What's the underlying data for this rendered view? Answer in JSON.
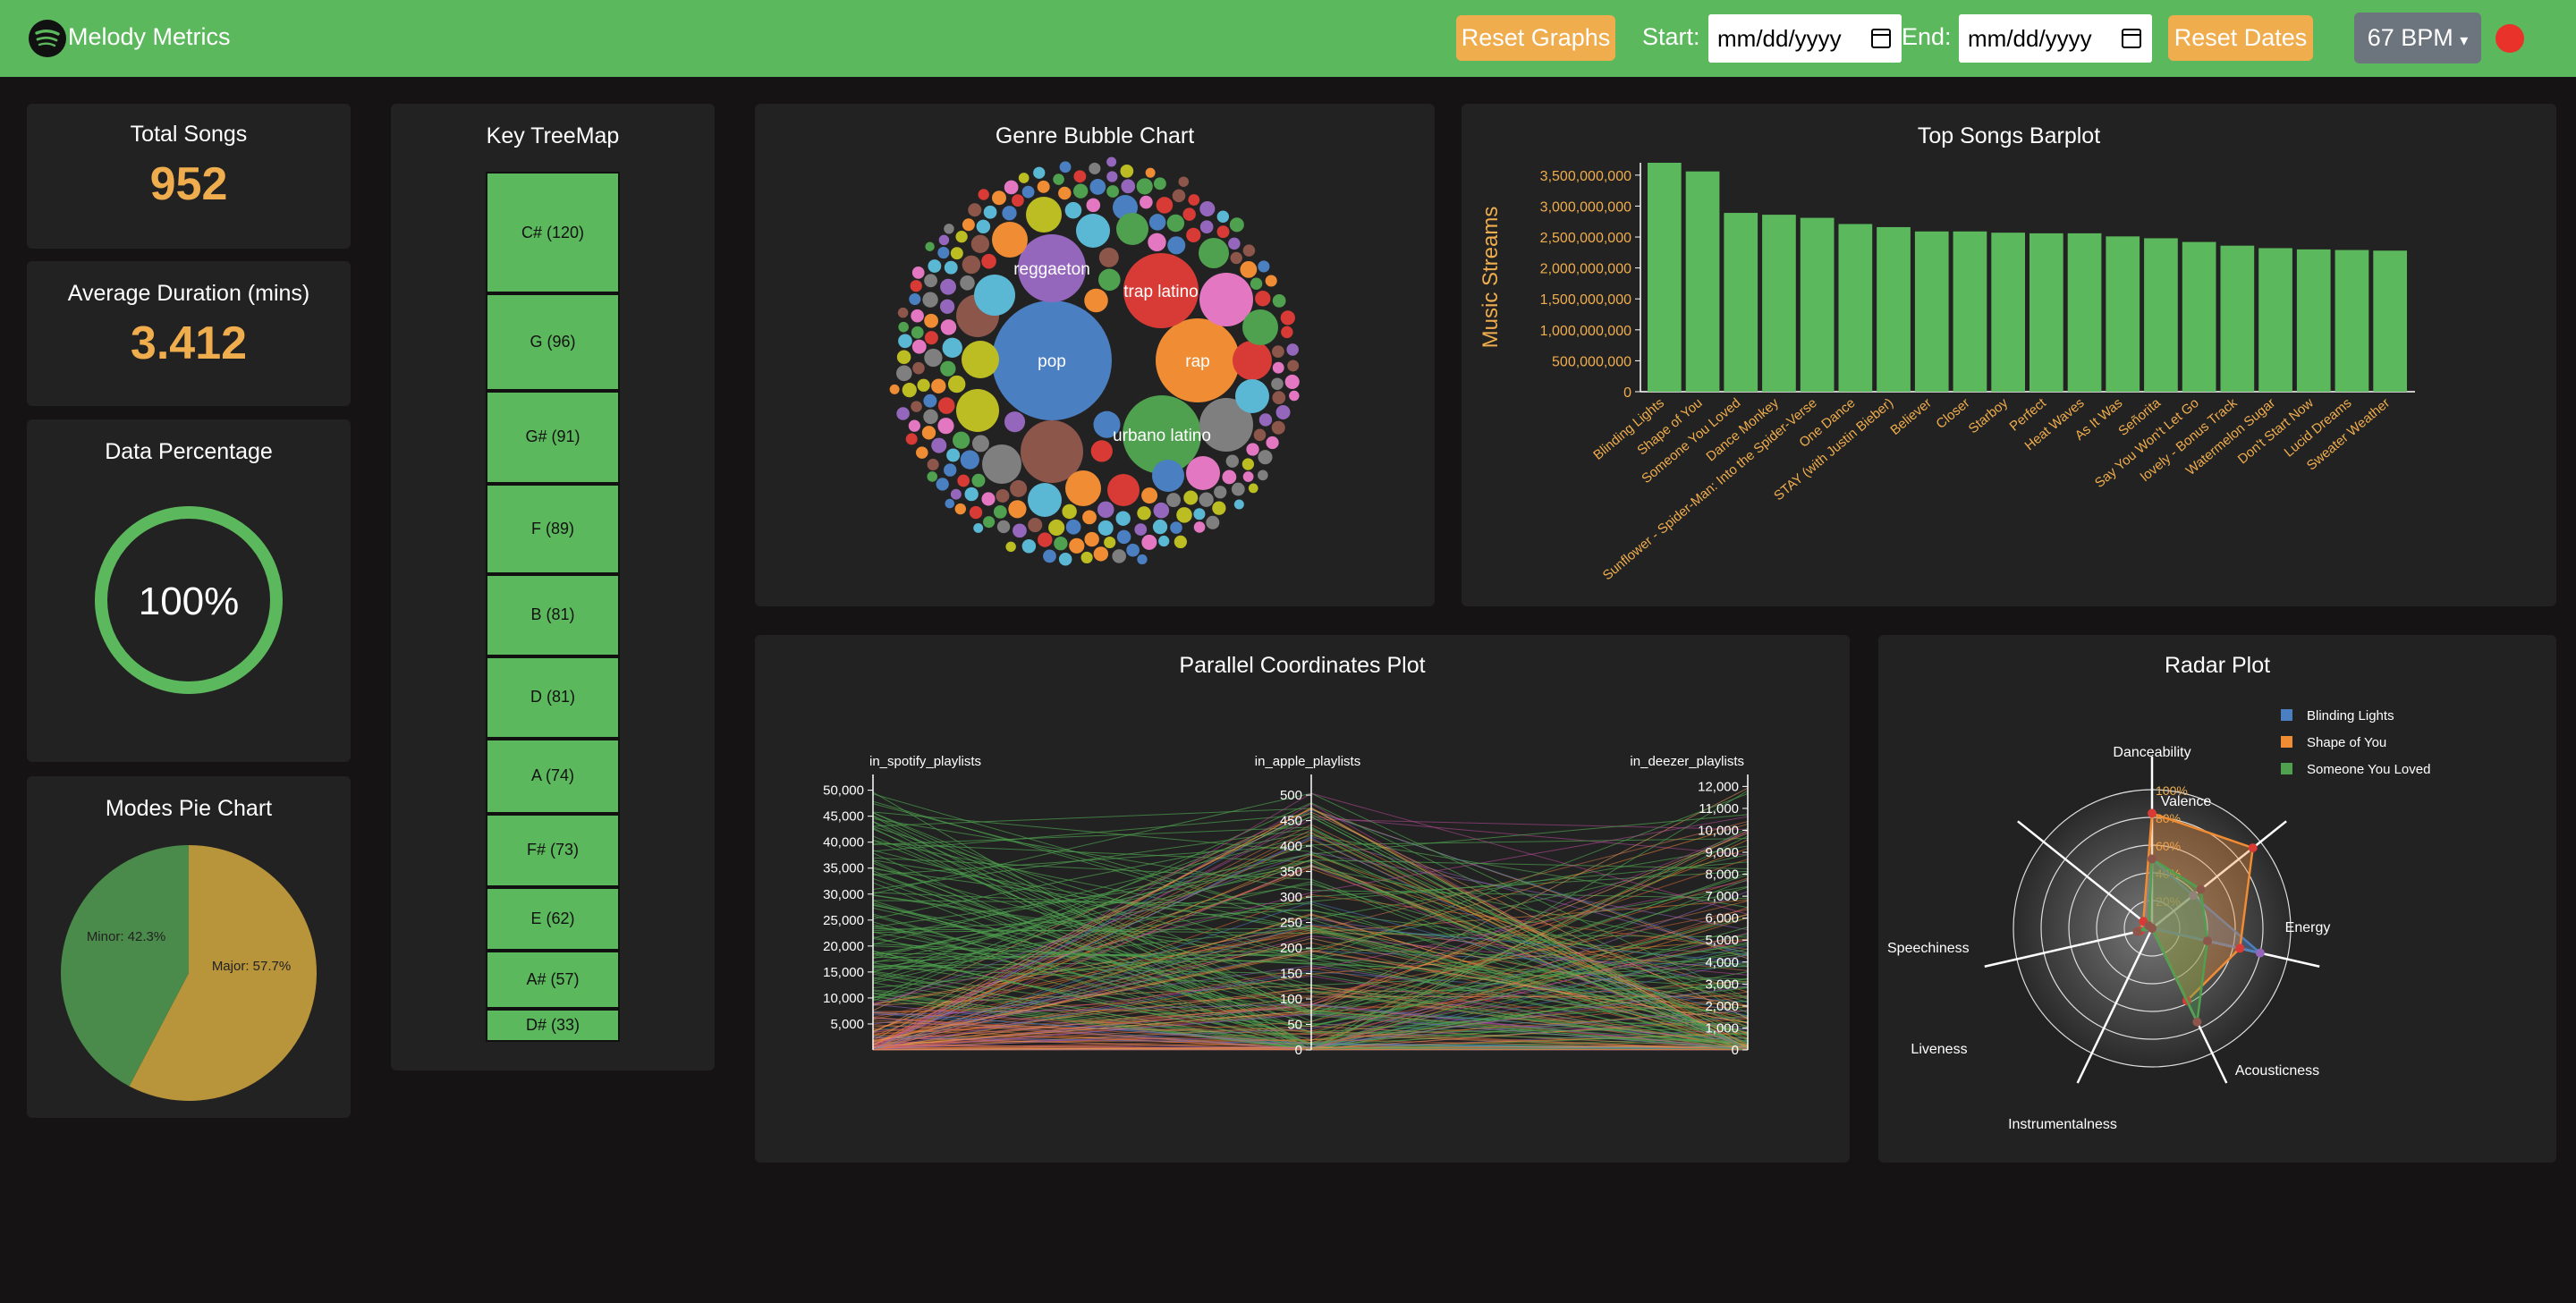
{
  "app": {
    "name": "Melody Metrics"
  },
  "nav": {
    "reset_graphs": "Reset Graphs",
    "start_label": "Start:",
    "start_placeholder": "mm/dd/yyyy",
    "end_label": "End:",
    "end_placeholder": "mm/dd/yyyy",
    "reset_dates": "Reset Dates",
    "bpm": "67 BPM"
  },
  "colors": {
    "green": "#5cb85c",
    "accent": "#f0ad4e",
    "panel": "#222222",
    "bg": "#151313",
    "pie_major": "#b8943a",
    "pie_minor": "#4a8a4a"
  },
  "stats": {
    "total_songs_title": "Total Songs",
    "total_songs": "952",
    "avg_duration_title": "Average Duration (mins)",
    "avg_duration": "3.412",
    "data_pct_title": "Data Percentage",
    "data_pct": "100%"
  },
  "pie": {
    "title": "Modes Pie Chart",
    "major_label": "Major: 57.7%",
    "minor_label": "Minor: 42.3%",
    "major": 57.7,
    "minor": 42.3
  },
  "treemap": {
    "title": "Key TreeMap",
    "keys": [
      {
        "label": "C# (120)",
        "value": 120
      },
      {
        "label": "G (96)",
        "value": 96
      },
      {
        "label": "G# (91)",
        "value": 91
      },
      {
        "label": "F (89)",
        "value": 89
      },
      {
        "label": "B (81)",
        "value": 81
      },
      {
        "label": "D (81)",
        "value": 81
      },
      {
        "label": "A (74)",
        "value": 74
      },
      {
        "label": "F# (73)",
        "value": 73
      },
      {
        "label": "E (62)",
        "value": 62
      },
      {
        "label": "A# (57)",
        "value": 57
      },
      {
        "label": "D# (33)",
        "value": 33
      }
    ]
  },
  "bubble": {
    "title": "Genre Bubble Chart",
    "genres": [
      "pop",
      "rap",
      "urbano latino",
      "trap latino",
      "reggaeton"
    ]
  },
  "chart_data": [
    {
      "type": "bar",
      "title": "Top Songs Barplot",
      "ylabel": "Music Streams",
      "ylim": [
        0,
        3700000000
      ],
      "categories": [
        "Blinding Lights",
        "Shape of You",
        "Someone You Loved",
        "Dance Monkey",
        "Sunflower - Spider-Man: Into the Spider-Verse",
        "One Dance",
        "STAY (with Justin Bieber)",
        "Believer",
        "Closer",
        "Starboy",
        "Perfect",
        "Heat Waves",
        "As It Was",
        "Señorita",
        "Say You Won't Let Go",
        "lovely - Bonus Track",
        "Watermelon Sugar",
        "Don't Start Now",
        "Lucid Dreams",
        "Sweater Weather"
      ],
      "values": [
        3700000000,
        3560000000,
        2890000000,
        2860000000,
        2810000000,
        2710000000,
        2660000000,
        2590000000,
        2590000000,
        2570000000,
        2560000000,
        2560000000,
        2510000000,
        2480000000,
        2420000000,
        2360000000,
        2320000000,
        2300000000,
        2290000000,
        2280000000
      ],
      "yticks": [
        "0",
        "500,000,000",
        "1,000,000,000",
        "1,500,000,000",
        "2,000,000,000",
        "2,500,000,000",
        "3,000,000,000",
        "3,500,000,000"
      ]
    },
    {
      "type": "line",
      "title": "Parallel Coordinates Plot",
      "axes": [
        {
          "name": "in_spotify_playlists",
          "max": 52000,
          "ticks": [
            "5,000",
            "10,000",
            "15,000",
            "20,000",
            "25,000",
            "30,000",
            "35,000",
            "40,000",
            "45,000",
            "50,000"
          ]
        },
        {
          "name": "in_apple_playlists",
          "max": 530,
          "ticks": [
            "0",
            "50",
            "100",
            "150",
            "200",
            "250",
            "300",
            "350",
            "400",
            "450",
            "500"
          ]
        },
        {
          "name": "in_deezer_playlists",
          "max": 12300,
          "ticks": [
            "0",
            "1,000",
            "2,000",
            "3,000",
            "4,000",
            "5,000",
            "6,000",
            "7,000",
            "8,000",
            "9,000",
            "10,000",
            "11,000",
            "12,000"
          ]
        }
      ]
    },
    {
      "type": "radar",
      "title": "Radar Plot",
      "axes": [
        "Danceability",
        "Valence",
        "Energy",
        "Acousticness",
        "Instrumentalness",
        "Liveness",
        "Speechiness"
      ],
      "rings": [
        "20%",
        "40%",
        "60%",
        "80%",
        "100%"
      ],
      "series": [
        {
          "name": "Blinding Lights",
          "color": "#4a7fc1",
          "values": [
            50,
            38,
            80,
            0,
            0,
            9,
            7
          ]
        },
        {
          "name": "Shape of You",
          "color": "#f08c33",
          "values": [
            83,
            93,
            65,
            58,
            0,
            9,
            8
          ]
        },
        {
          "name": "Someone You Loved",
          "color": "#4fa04f",
          "values": [
            50,
            45,
            41,
            75,
            0,
            11,
            3
          ]
        }
      ]
    }
  ]
}
